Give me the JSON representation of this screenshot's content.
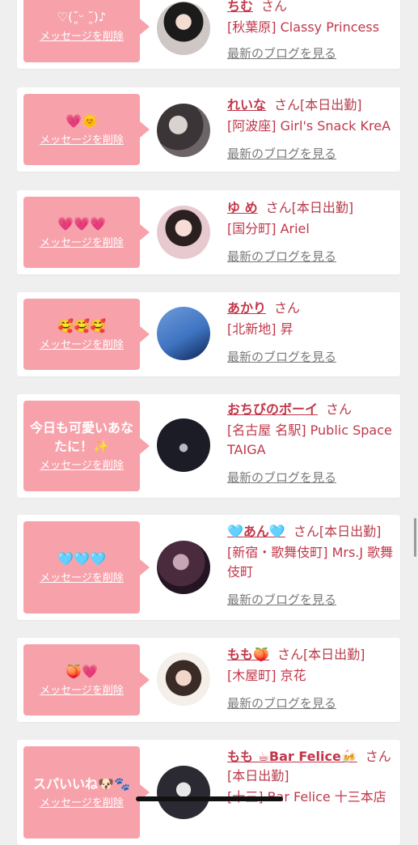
{
  "delete_label": "メッセージを削除",
  "blog_label": "最新のブログを見る",
  "entries": [
    {
      "message": "♡(˘͈ᵕ ˘͈)♪",
      "name": "ちむ",
      "suffix": "さん",
      "shop": "[秋葉原] Classy Princess"
    },
    {
      "message": "💗🌞",
      "name": "れいな",
      "suffix": "さん[本日出勤]",
      "shop": "[阿波座] Girl's Snack KreA"
    },
    {
      "message": "💗💗💗",
      "name": "ゆ め",
      "suffix": "さん[本日出勤]",
      "shop": "[国分町] Ariel"
    },
    {
      "message": "🥰🥰🥰",
      "name": "あかり",
      "suffix": "さん",
      "shop": "[北新地] 昇"
    },
    {
      "message": "今日も可愛いあなたに！✨",
      "name": "おちびのボーイ",
      "suffix": "さん",
      "shop": "[名古屋 名駅] Public Space TAIGA"
    },
    {
      "message": "🩵🩵🩵",
      "name": "🩵あん🩵",
      "suffix": "さん[本日出勤]",
      "shop": "[新宿・歌舞伎町] Mrs.J 歌舞伎町"
    },
    {
      "message": "🍑💗",
      "name": "もも🍑",
      "suffix": "さん[本日出勤]",
      "shop": "[木屋町] 京花"
    },
    {
      "message": "スパいいね🐶🐾",
      "name": "もも ☕Bar Felice🍻",
      "suffix": "さん[本日出勤]",
      "shop": "[十三] Bar Felice 十三本店"
    }
  ],
  "colors": {
    "bubble": "#f7a2ab",
    "name": "#c2374a",
    "background": "#efefef"
  }
}
